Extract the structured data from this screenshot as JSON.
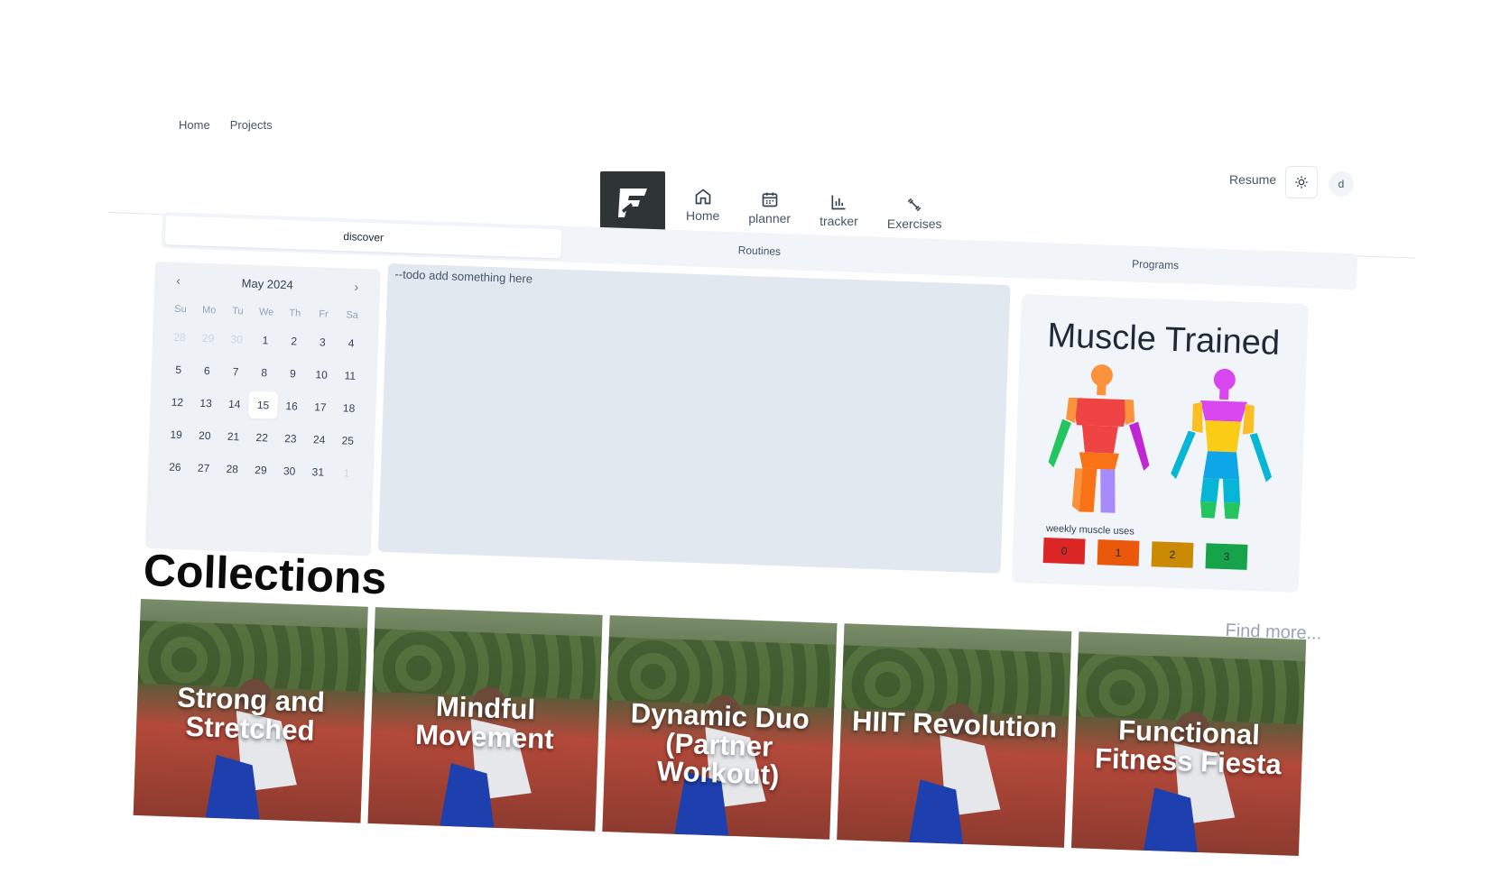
{
  "topnav": {
    "home": "Home",
    "projects": "Projects"
  },
  "header": {
    "nav": [
      {
        "label": "Home",
        "icon": "home-icon"
      },
      {
        "label": "planner",
        "icon": "calendar-icon"
      },
      {
        "label": "tracker",
        "icon": "bar-chart-icon"
      },
      {
        "label": "Exercises",
        "icon": "dumbbell-icon"
      }
    ],
    "resume": "Resume",
    "avatar": "d"
  },
  "tabs": [
    "discover",
    "Routines",
    "Programs"
  ],
  "calendar": {
    "month": "May 2024",
    "dow": [
      "Su",
      "Mo",
      "Tu",
      "We",
      "Th",
      "Fr",
      "Sa"
    ],
    "days": [
      "28",
      "29",
      "30",
      "1",
      "2",
      "3",
      "4",
      "5",
      "6",
      "7",
      "8",
      "9",
      "10",
      "11",
      "12",
      "13",
      "14",
      "15",
      "16",
      "17",
      "18",
      "19",
      "20",
      "21",
      "22",
      "23",
      "24",
      "25",
      "26",
      "27",
      "28",
      "29",
      "30",
      "31",
      "1"
    ],
    "selected": "15"
  },
  "todo": "--todo add something here",
  "muscle": {
    "title": "Muscle Trained",
    "legend_label": "weekly muscle uses",
    "legend": [
      {
        "value": "0",
        "color": "#dc2626"
      },
      {
        "value": "1",
        "color": "#ea580c"
      },
      {
        "value": "2",
        "color": "#ca8a04"
      },
      {
        "value": "3",
        "color": "#16a34a"
      }
    ]
  },
  "collections": {
    "title": "Collections",
    "find_more": "Find more...",
    "cards": [
      "Strong and Stretched",
      "Mindful Movement",
      "Dynamic Duo (Partner Workout)",
      "HIIT Revolution",
      "Functional Fitness Fiesta"
    ]
  }
}
